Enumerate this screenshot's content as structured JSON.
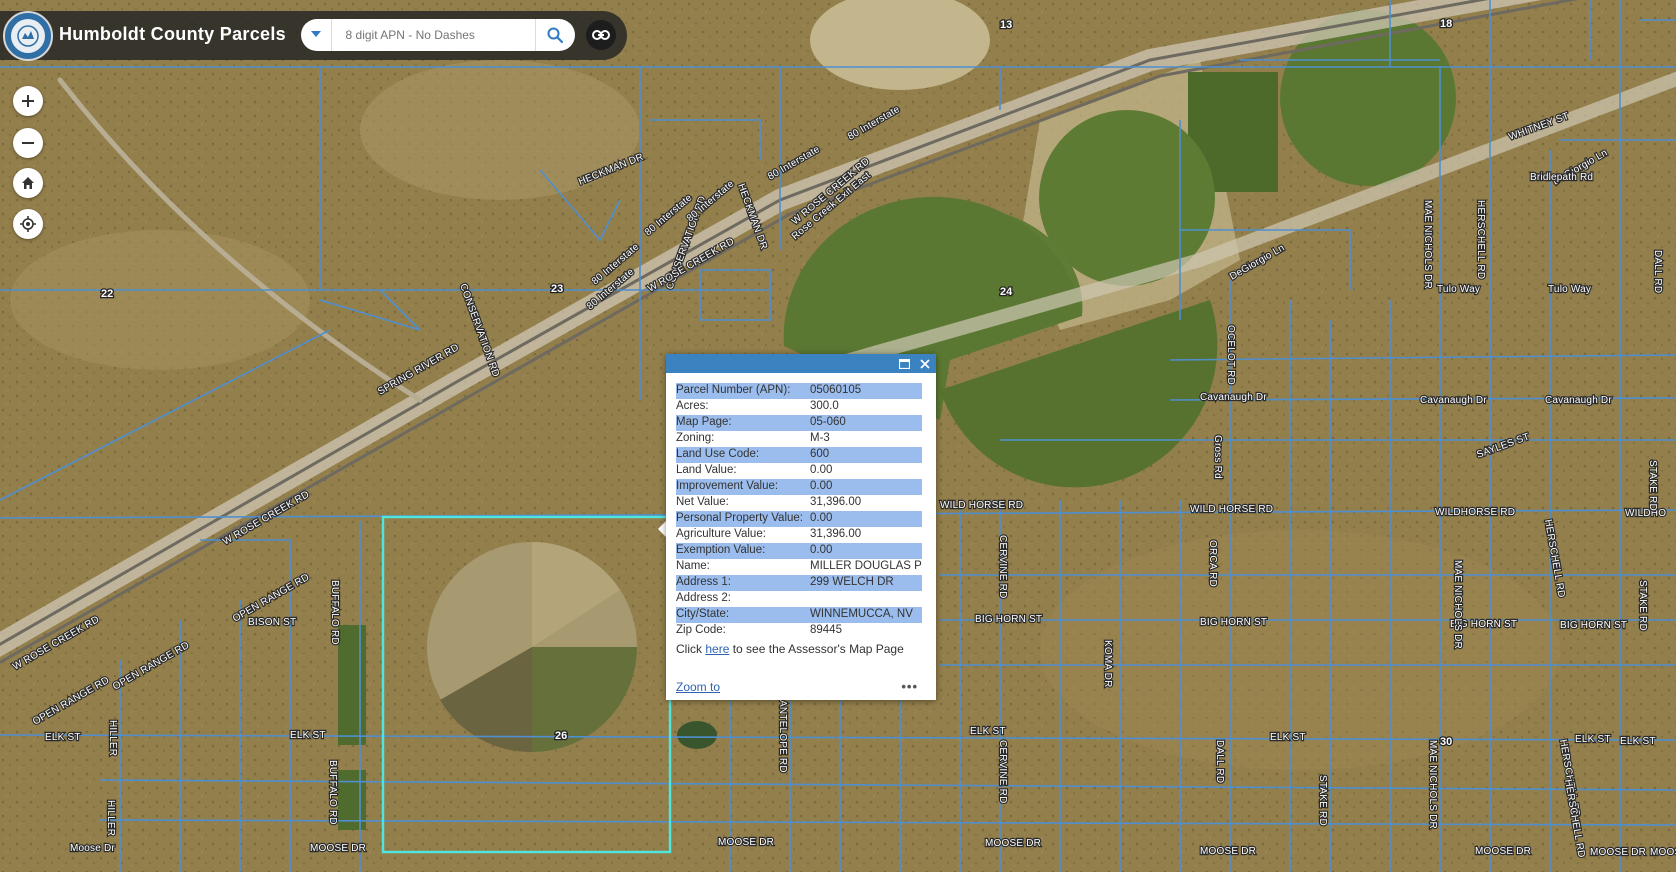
{
  "app": {
    "title": "Humboldt County Parcels"
  },
  "search": {
    "placeholder": "8 digit APN - No Dashes"
  },
  "icons": {
    "logo": "county-seal-icon",
    "search_dropdown": "caret-down-icon",
    "search": "magnifier-icon",
    "link": "link-icon",
    "zoom_in": "plus-icon",
    "zoom_out": "minus-icon",
    "home": "home-icon",
    "locate": "locate-icon",
    "popup_dock": "dock-icon",
    "popup_close": "close-icon"
  },
  "colors": {
    "parcel_line": "#4f8fd0",
    "selected_parcel": "#4fe6e0",
    "popup_header": "#3a83c0",
    "row_highlight": "#9bbdee"
  },
  "popup": {
    "fields": [
      {
        "label": "Parcel Number (APN):",
        "value": "05060105"
      },
      {
        "label": "Acres:",
        "value": "300.0"
      },
      {
        "label": "Map Page:",
        "value": "05-060"
      },
      {
        "label": "Zoning:",
        "value": "M-3"
      },
      {
        "label": "Land Use Code:",
        "value": "600"
      },
      {
        "label": "Land Value:",
        "value": "0.00"
      },
      {
        "label": "Improvement Value:",
        "value": "0.00"
      },
      {
        "label": "Net Value:",
        "value": "31,396.00"
      },
      {
        "label": "Personal Property Value:",
        "value": "0.00"
      },
      {
        "label": "Agriculture Value:",
        "value": "31,396.00"
      },
      {
        "label": "Exemption Value:",
        "value": "0.00"
      },
      {
        "label": "Name:",
        "value": "MILLER DOUGLAS P"
      },
      {
        "label": "Address 1:",
        "value": "299 WELCH DR"
      },
      {
        "label": "Address 2:",
        "value": ""
      },
      {
        "label": "City/State:",
        "value": "WINNEMUCCA, NV"
      },
      {
        "label": "Zip Code:",
        "value": "89445"
      }
    ],
    "note_prefix": "Click",
    "note_link": "here",
    "note_suffix": "to see the Assessor's Map Page",
    "zoom_to": "Zoom to",
    "more": "•••"
  },
  "map_labels": {
    "sections": [
      "13",
      "18",
      "22",
      "23",
      "24",
      "26",
      "30"
    ],
    "roads": [
      "HECKMAN DR",
      "CONSERVATION RD",
      "HECKMAN DR",
      "80 Interstate",
      "80 Interstate",
      "80 Interstate",
      "80 Interstate",
      "80 Interstate",
      "80 Interstate",
      "Rose Creek Exit East",
      "W ROSE CREEK RD",
      "W ROSE CREEK RD",
      "CONSERVATION RD",
      "SPRING RIVER RD",
      "WHITNEY ST",
      "DeGiorgio Ln",
      "Bridlepath Rd",
      "DeGiorgio Ln",
      "Tulo Way",
      "Tulo Way",
      "Cavanaugh Dr",
      "Cavanaugh Dr",
      "Cavanaugh Dr",
      "WILD HORSE RD",
      "WILD HORSE RD",
      "WILDHORSE RD",
      "WILDHO",
      "W ROSE CREEK RD",
      "OPEN RANGE RD",
      "BISON ST",
      "W ROSE CREEK RD",
      "OPEN RANGE RD",
      "OPEN RANGE RD",
      "ELK ST",
      "ELK ST",
      "ELK ST",
      "ELK ST",
      "ELK ST",
      "ELK ST",
      "BIG HORN ST",
      "BIG HORN ST",
      "BIG HORN ST",
      "BIG HORN ST",
      "MOOSE DR",
      "MOOSE DR",
      "MOOSE DR",
      "MOOSE DR",
      "MOOSE DR",
      "MOOSE DR",
      "Moose Dr",
      "MOOSE DR",
      "SAYLES ST",
      "HERSCHELL RD",
      "HERSCHELL RD",
      "HERSCHELL RD",
      "HERSCHELL RD",
      "MAE NICHOLS DR",
      "MAE NICHOLS DR",
      "MAE NICHOLS DR",
      "CERVINE RD",
      "CERVINE RD",
      "ANTELOPE RD",
      "BUFFALO RD",
      "BUFFALO RD",
      "HILLER",
      "HILLER",
      "ORCA RD",
      "DALL RD",
      "DALL RD",
      "STAKE RD",
      "STAKE RD",
      "STAKE RD",
      "KOMA DR",
      "OCELOT RD",
      "Gross Rd",
      "Gross Rd"
    ]
  }
}
